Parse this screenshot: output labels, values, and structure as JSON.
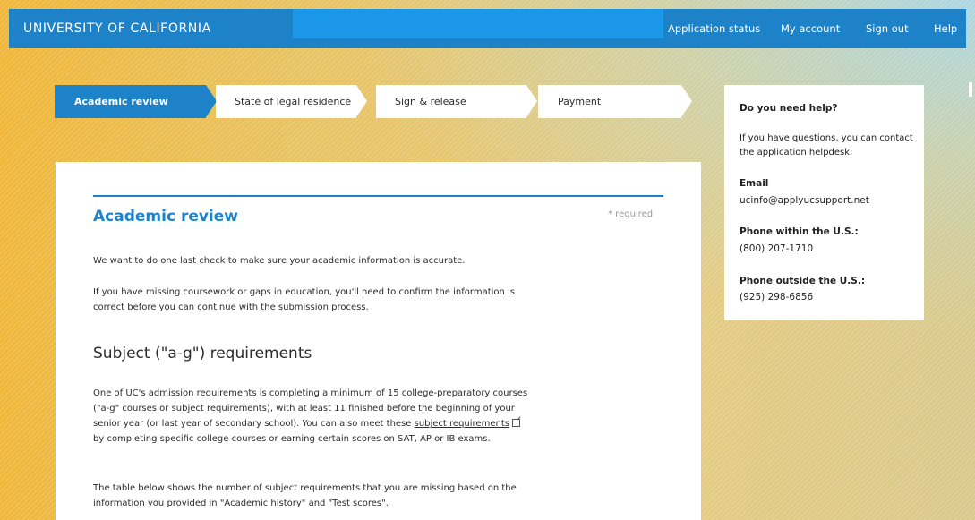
{
  "header": {
    "brand": "UNIVERSITY OF CALIFORNIA",
    "nav": {
      "status": "Application status",
      "account": "My account",
      "signout": "Sign out",
      "help": "Help"
    }
  },
  "steps": [
    {
      "label": "Academic review",
      "active": true
    },
    {
      "label": "State of legal residence",
      "active": false
    },
    {
      "label": "Sign & release",
      "active": false
    },
    {
      "label": "Payment",
      "active": false
    }
  ],
  "main": {
    "title": "Academic review",
    "required_note": "* required",
    "intro": "We want to do one last check to make sure your academic information is accurate.",
    "missing_note": "If you have missing coursework or gaps in education, you'll need to confirm the information is correct before you can continue with the submission process.",
    "subject_heading": "Subject (\"a-g\") requirements",
    "subject_text_before": "One of UC's admission requirements is completing a minimum of 15 college-preparatory courses (\"a-g\" courses or subject requirements), with at least 11 finished before the beginning of your senior year (or last year of secondary school). You can also meet these",
    "subject_link": "subject requirements",
    "subject_text_after": "by completing specific college courses or earning certain scores on SAT, AP or IB exams.",
    "table_note": "The table below shows the number of subject requirements that you are missing based on the information you provided in \"Academic history\" and \"Test scores\"."
  },
  "help": {
    "title": "Do you need help?",
    "description": "If you have questions, you can contact the application helpdesk:",
    "email_label": "Email",
    "email": "ucinfo@applyucsupport.net",
    "phone_us_label": "Phone within the U.S.:",
    "phone_us": "(800) 207-1710",
    "phone_intl_label": "Phone outside the U.S.:",
    "phone_intl": "(925) 298-6856"
  },
  "colors": {
    "brand_blue": "#1e82c9",
    "accent_blue": "#1a97e6"
  },
  "icons": {
    "external_link": "external-link-icon"
  }
}
